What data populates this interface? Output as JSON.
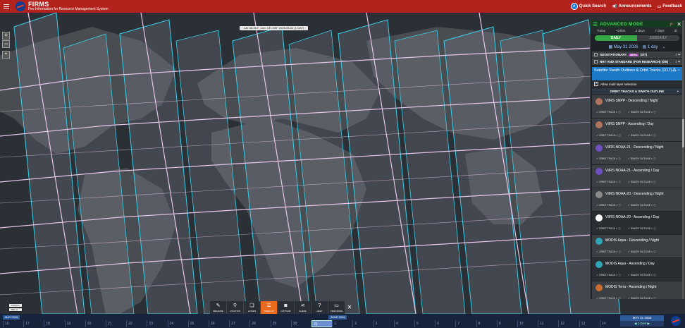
{
  "header": {
    "app_name": "FIRMS",
    "subtitle": "Fire Information for Resource Management System",
    "quick_search": "Quick Search",
    "announcements": "Announcements",
    "feedback": "Feedback"
  },
  "map": {
    "coord_readout": "Lat: 46.314°, Lon: 137.400°      2026-05-31 (1 DAY)",
    "zoom_in": "+",
    "zoom_out": "−",
    "scale_top": "1000 km",
    "scale_bottom": "500 mi"
  },
  "toolbar": {
    "items": [
      {
        "label": "MEASURE",
        "icon": "ruler"
      },
      {
        "label": "LOCATION",
        "icon": "pin"
      },
      {
        "label": "LAYERS",
        "icon": "layers"
      },
      {
        "label": "TIMEFLAP",
        "icon": "menu"
      },
      {
        "label": "CAPTURE",
        "icon": "camera"
      },
      {
        "label": "SHARE",
        "icon": "share"
      },
      {
        "label": "HELP",
        "icon": "help"
      },
      {
        "label": "VIEW MODE",
        "icon": "monitor"
      }
    ],
    "active_index": 3
  },
  "timeline": {
    "month_left": "MAY 2026",
    "month_right": "JUNE 2026",
    "days": [
      "16",
      "17",
      "18",
      "19",
      "20",
      "21",
      "22",
      "23",
      "24",
      "25",
      "26",
      "27",
      "28",
      "29",
      "30",
      "31",
      "1",
      "2",
      "3",
      "4",
      "5",
      "6",
      "7",
      "8",
      "9",
      "10",
      "11",
      "12",
      "13",
      "14"
    ],
    "selected_day": "31",
    "current_date": "MAY 31 2026",
    "range": "1 DAY"
  },
  "panel": {
    "mode_title": "ADVANCED MODE",
    "ranges": [
      "Today",
      "~24hrs",
      "3 days",
      "7 days"
    ],
    "toggle_on": "DAILY",
    "toggle_off": "SUBDAILY",
    "date": "May 31 2026",
    "period": "1 day",
    "categories": [
      {
        "label": "GEOSTATIONARY",
        "badge": "BETA",
        "count": "(0/7)"
      },
      {
        "label": "NRT AND STANDARD (FOR RESEARCH) (0/8)",
        "badge": "",
        "count": ""
      }
    ],
    "selected_layer": "Satellite Swath Outlines & Orbit Tracks (2/17)",
    "multi_select": "Allow multi layer selection",
    "orbit_header": "ORBIT TRACKS & SWATH OUTLINE",
    "orbit_track_label": "ORBIT TRACK",
    "swath_outline_label": "SWATH OUTLINE",
    "items": [
      {
        "label": "VIIRS SNPP - Descending / Night",
        "color": "#b0735b",
        "active": false
      },
      {
        "label": "VIIRS SNPP - Ascending / Day",
        "color": "#b0735b",
        "active": false
      },
      {
        "label": "VIIRS NOAA-21 - Descending / Night",
        "color": "#6d4fc0",
        "active": false
      },
      {
        "label": "VIIRS NOAA-21 - Ascending / Day",
        "color": "#6d4fc0",
        "active": false
      },
      {
        "label": "VIIRS NOAA-20 - Descending / Night",
        "color": "#8a8a8a",
        "active": false
      },
      {
        "label": "VIIRS NOAA-20 - Ascending / Day",
        "color": "#ffffff",
        "active": true
      },
      {
        "label": "MODIS Aqua - Descending / Night",
        "color": "#2fa6b6",
        "active": false
      },
      {
        "label": "MODIS Aqua - Ascending / Day",
        "color": "#2fa6b6",
        "active": true
      },
      {
        "label": "MODIS Terra - Ascending / Night",
        "color": "#c96a2e",
        "active": false
      }
    ]
  }
}
